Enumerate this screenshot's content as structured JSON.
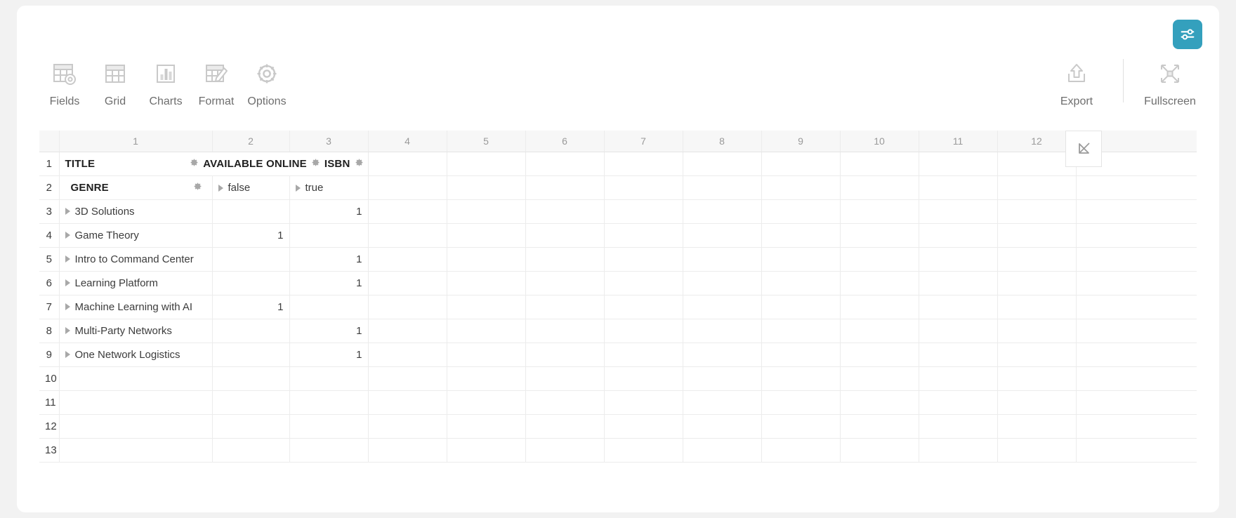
{
  "settings_button": {
    "icon": "sliders-icon",
    "accent": "#34a0bd"
  },
  "toolbar": {
    "left_items": [
      {
        "label": "Fields",
        "icon": "fields-icon"
      },
      {
        "label": "Grid",
        "icon": "grid-icon"
      },
      {
        "label": "Charts",
        "icon": "charts-icon"
      },
      {
        "label": "Format",
        "icon": "format-icon"
      },
      {
        "label": "Options",
        "icon": "options-gear-icon"
      }
    ],
    "right_items": [
      {
        "label": "Export",
        "icon": "export-upload-icon"
      },
      {
        "label": "Fullscreen",
        "icon": "fullscreen-expand-icon"
      }
    ]
  },
  "grid": {
    "column_numbers": [
      "1",
      "2",
      "3",
      "4",
      "5",
      "6",
      "7",
      "8",
      "9",
      "10",
      "11",
      "12"
    ],
    "row_numbers": [
      "1",
      "2",
      "3",
      "4",
      "5",
      "6",
      "7",
      "8",
      "9",
      "10",
      "11",
      "12",
      "13"
    ],
    "collapse_widget_icon": "collapse-arrow-icon",
    "header_row": {
      "row_number": "1",
      "fields": [
        {
          "label": "TITLE",
          "gear": "gear-icon"
        },
        {
          "label": "AVAILABLE ONLINE",
          "gear": "gear-icon"
        },
        {
          "label": "ISBN",
          "gear": "gear-icon"
        }
      ]
    },
    "axis_row": {
      "row_number": "2",
      "row_field": {
        "label": "GENRE",
        "gear": "gear-icon"
      },
      "column_values": [
        {
          "label": "false",
          "expander": "expand-triangle-icon"
        },
        {
          "label": "true",
          "expander": "expand-triangle-icon"
        }
      ]
    },
    "data_rows": [
      {
        "row_number": "3",
        "genre": "3D Solutions",
        "false": "",
        "true": "1"
      },
      {
        "row_number": "4",
        "genre": "Game Theory",
        "false": "1",
        "true": ""
      },
      {
        "row_number": "5",
        "genre": "Intro to Command Center",
        "false": "",
        "true": "1"
      },
      {
        "row_number": "6",
        "genre": "Learning Platform",
        "false": "",
        "true": "1"
      },
      {
        "row_number": "7",
        "genre": "Machine Learning with AI",
        "false": "1",
        "true": ""
      },
      {
        "row_number": "8",
        "genre": "Multi-Party Networks",
        "false": "",
        "true": "1"
      },
      {
        "row_number": "9",
        "genre": "One Network Logistics",
        "false": "",
        "true": "1"
      }
    ],
    "empty_rows": [
      "10",
      "11",
      "12",
      "13"
    ]
  }
}
